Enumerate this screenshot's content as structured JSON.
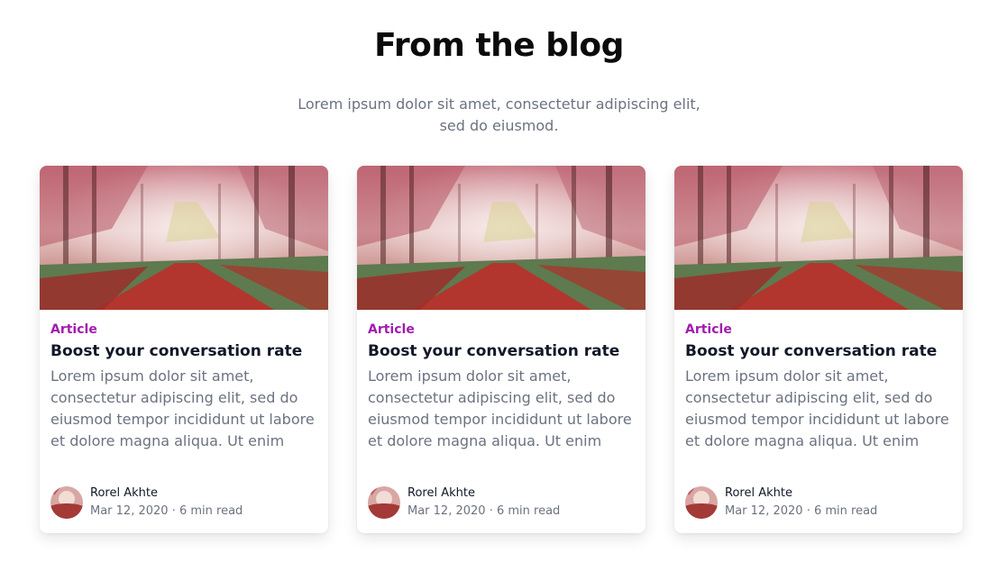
{
  "section": {
    "title": "From the blog",
    "subtitle_line1": "Lorem ipsum dolor sit amet, consectetur adipiscing elit,",
    "subtitle_line2": "sed do eiusmod."
  },
  "colors": {
    "category": "#a21caf",
    "title": "#111827",
    "muted": "#6b7280"
  },
  "posts": [
    {
      "category": "Article",
      "title": "Boost your conversation rate",
      "excerpt_lines": [
        "Lorem ipsum dolor sit amet,",
        "consectetur adipiscing elit, sed do",
        "eiusmod tempor incididunt ut labore",
        "et dolore magna aliqua. Ut enim"
      ],
      "image": "autumn-forest-path-photo",
      "author": "Rorel Akhte",
      "date": "Mar 12, 2020",
      "separator": "·",
      "read_time": "6 min read"
    },
    {
      "category": "Article",
      "title": "Boost your conversation rate",
      "excerpt_lines": [
        "Lorem ipsum dolor sit amet,",
        "consectetur adipiscing elit, sed do",
        "eiusmod tempor incididunt ut labore",
        "et dolore magna aliqua. Ut enim"
      ],
      "image": "autumn-forest-path-photo",
      "author": "Rorel Akhte",
      "date": "Mar 12, 2020",
      "separator": "·",
      "read_time": "6 min read"
    },
    {
      "category": "Article",
      "title": "Boost your conversation rate",
      "excerpt_lines": [
        "Lorem ipsum dolor sit amet,",
        "consectetur adipiscing elit, sed do",
        "eiusmod tempor incididunt ut labore",
        "et dolore magna aliqua. Ut enim"
      ],
      "image": "autumn-forest-path-photo",
      "author": "Rorel Akhte",
      "date": "Mar 12, 2020",
      "separator": "·",
      "read_time": "6 min read"
    }
  ]
}
